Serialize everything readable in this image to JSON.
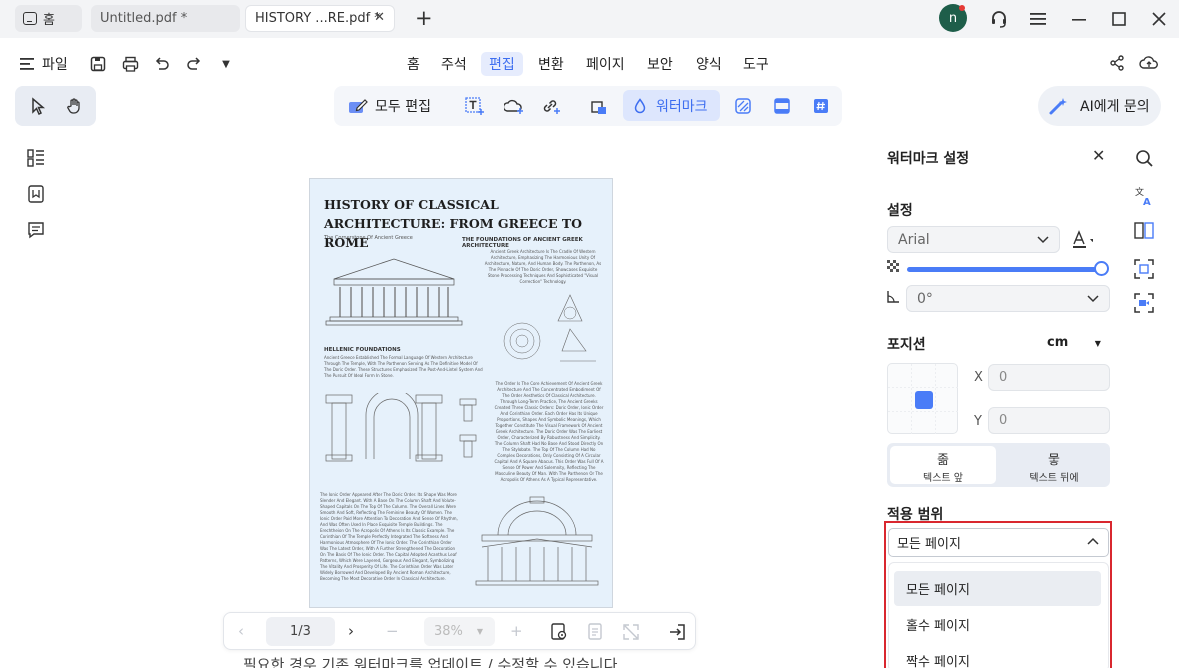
{
  "tabs": {
    "home": "홈",
    "untitled": "Untitled.pdf *",
    "active": "HISTORY ...RE.pdf *"
  },
  "window": {
    "avatar_letter": "n"
  },
  "menubar": {
    "file": "파일",
    "items": [
      "홈",
      "주석",
      "편집",
      "변환",
      "페이지",
      "보안",
      "양식",
      "도구"
    ],
    "active_item": "편집"
  },
  "toolbar": {
    "edit_all": "모두 편집",
    "watermark": "워터마크",
    "ai_button": "AI에게 문의"
  },
  "document": {
    "title": "HISTORY OF CLASSICAL  ARCHITECTURE: FROM GREECE TO ROME",
    "subtitle": "The Cornerstone Of Ancient Greece",
    "section1": "THE FOUNDATIONS OF ANCIENT GREEK ARCHITECTURE",
    "section1_text": "Ancient Greek Architecture Is The Cradle Of Western Architecture, Emphasizing The Harmonious Unity Of Architecture, Nature, And Human Body. The Parthenon, As The Pinnacle Of The Doric Order, Showcases Exquisite Stone Processing Techniques And Sophisticated \"Visual Correction\" Technology.",
    "section2": "HELLENIC FOUNDATIONS",
    "section2_text": "Ancient Greece Established The Formal Language Of Western Architecture Through The Temple, With The Parthenon Serving As The Definitive Model Of The Doric Order. These Structures Emphasized The Post-And-Lintel System And The Pursuit Of Ideal Form In Stone.",
    "section3_text": "The Order Is The Core Achievement Of Ancient Greek Architecture And The Concentrated Embodiment Of The Order Aesthetics Of Classical Architecture. Through Long-Term Practice, The Ancient Greeks Created Three Classic Orders: Doric Order, Ionic Order And Corinthian Order. Each Order Has Its Unique Proportions, Shapes And Symbolic Meanings, Which Together Constitute The Visual Framework Of Ancient Greek Architecture. The Doric Order Was The Earliest Order, Characterized By Robustness And Simplicity. The Column Shaft Had No Base And Stood Directly On The Stylobate. The Top Of The Column Had No Complex Decorations, Only Consisting Of A Circular Capital And A Square Abacus. This Order Was Full Of A Sense Of Power And Solemnity, Reflecting The Masculine Beauty Of Man. With The Parthenon Or The Acropolis Of Athens As A Typical Representative.",
    "section4_text": "The Ionic Order Appeared After The Doric Order. Its Shape Was More Slender And Elegant. With A Base On The Column Shaft And Volute-Shaped Capitals On The Top Of The Column. The Overall Lines Were Smooth And Soft, Reflecting The Feminine Beauty Of Women. The Ionic Order Paid More Attention To Decoration And Sense Of Rhythm, And Was Often Used In Place Exquisite Temple Buildings. The Erechtheion On The Acropolis Of Athens Is Its Classic Example. The Corinthian Of The Temple Perfectly Integrated The Softness And Harmonious Atmosphere Of The Ionic Order. The Corinthian Order Was The Latest Order, With A Further Strengthened The Decoration On The Basis Of The Ionic Order. The Capital Adopted Acanthus Leaf Patterns, Which Were Layered, Gorgeous And Elegant, Symbolizing The Vitality And Prosperity Of Life. The Corinthian Order Was Later Widely Borrowed And Developed By Ancient Roman Architecture, Becoming The Most Decorative Order In Classical Architecture."
  },
  "bottom_nav": {
    "page": "1/3",
    "zoom": "38%"
  },
  "below_text": "필요한 경우 기존 워터마크를 업데이트 / 수정할 수 있습니다.",
  "panel": {
    "title": "워터마크 설정",
    "settings_label": "설정",
    "font": "Arial",
    "opacity_percent": 100,
    "rotation": "0°",
    "position_label": "포지션",
    "unit": "cm",
    "x_label": "X",
    "x_value": "0",
    "y_label": "Y",
    "y_value": "0",
    "front_glyph": "졺",
    "front_label": "텍스트 앞",
    "back_glyph": "뭏",
    "back_label": "텍스트 뒤에",
    "scope_label": "적용 범위",
    "scope_selected": "모든 페이지",
    "scope_options": [
      "모든 페이지",
      "홀수 페이지",
      "짝수 페이지"
    ]
  },
  "colors": {
    "accent": "#4a7cf7",
    "highlight_border": "#d9272f",
    "page_bg": "#e6f1fb"
  }
}
